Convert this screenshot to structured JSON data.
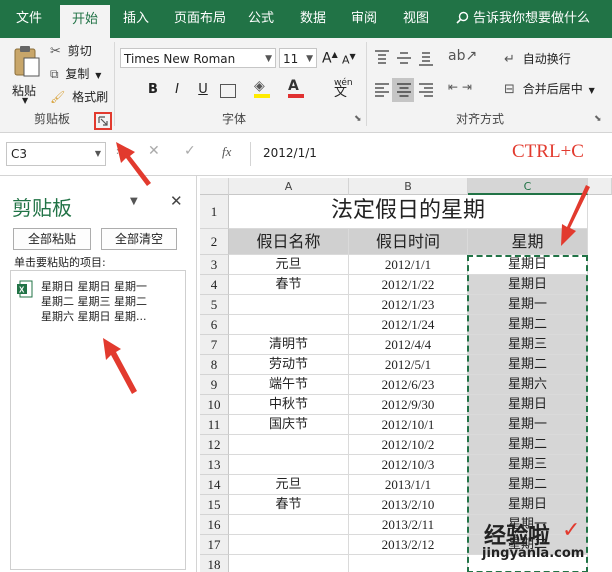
{
  "ribbon": {
    "tabs": [
      "文件",
      "开始",
      "插入",
      "页面布局",
      "公式",
      "数据",
      "审阅",
      "视图"
    ],
    "tell_me": "告诉我你想要做什么",
    "clipboard": {
      "paste": "粘贴",
      "cut": "剪切",
      "copy": "复制",
      "format_painter": "格式刷",
      "group": "剪贴板"
    },
    "font": {
      "name": "Times New Roman",
      "size": "11",
      "bold": "B",
      "italic": "I",
      "underline": "U",
      "phonetic": "wén",
      "group": "字体"
    },
    "alignment": {
      "wrap": "自动换行",
      "merge": "合并后居中",
      "group": "对齐方式"
    }
  },
  "formula_bar": {
    "name_box": "C3",
    "fx": "fx",
    "value": "2012/1/1"
  },
  "annotation": "CTRL+C",
  "pane": {
    "title": "剪贴板",
    "paste_all": "全部粘贴",
    "clear_all": "全部清空",
    "hint": "单击要粘贴的项目:",
    "item_lines": [
      "星期日 星期日 星期一",
      "星期二 星期三 星期二",
      "星期六 星期日 星期..."
    ]
  },
  "sheet": {
    "columns": [
      "A",
      "B",
      "C"
    ],
    "title": "法定假日的星期",
    "headers": [
      "假日名称",
      "假日时间",
      "星期"
    ],
    "rows": [
      {
        "num": "3",
        "a": "元旦",
        "b": "2012/1/1",
        "c": "星期日"
      },
      {
        "num": "4",
        "a": "春节",
        "b": "2012/1/22",
        "c": "星期日"
      },
      {
        "num": "5",
        "a": "",
        "b": "2012/1/23",
        "c": "星期一"
      },
      {
        "num": "6",
        "a": "",
        "b": "2012/1/24",
        "c": "星期二"
      },
      {
        "num": "7",
        "a": "清明节",
        "b": "2012/4/4",
        "c": "星期三"
      },
      {
        "num": "8",
        "a": "劳动节",
        "b": "2012/5/1",
        "c": "星期二"
      },
      {
        "num": "9",
        "a": "端午节",
        "b": "2012/6/23",
        "c": "星期六"
      },
      {
        "num": "10",
        "a": "中秋节",
        "b": "2012/9/30",
        "c": "星期日"
      },
      {
        "num": "11",
        "a": "国庆节",
        "b": "2012/10/1",
        "c": "星期一"
      },
      {
        "num": "12",
        "a": "",
        "b": "2012/10/2",
        "c": "星期二"
      },
      {
        "num": "13",
        "a": "",
        "b": "2012/10/3",
        "c": "星期三"
      },
      {
        "num": "14",
        "a": "元旦",
        "b": "2013/1/1",
        "c": "星期二"
      },
      {
        "num": "15",
        "a": "春节",
        "b": "2013/2/10",
        "c": "星期日"
      },
      {
        "num": "16",
        "a": "",
        "b": "2013/2/11",
        "c": "星期一"
      },
      {
        "num": "17",
        "a": "",
        "b": "2013/2/12",
        "c": "星期二"
      },
      {
        "num": "18",
        "a": "",
        "b": "",
        "c": ""
      }
    ]
  },
  "watermark": {
    "brand": "经验啦",
    "url": "jingyanla.com"
  },
  "colors": {
    "excel_green": "#217346",
    "selection_fill": "#d6d6d6",
    "annotation_red": "#e23a2e"
  }
}
